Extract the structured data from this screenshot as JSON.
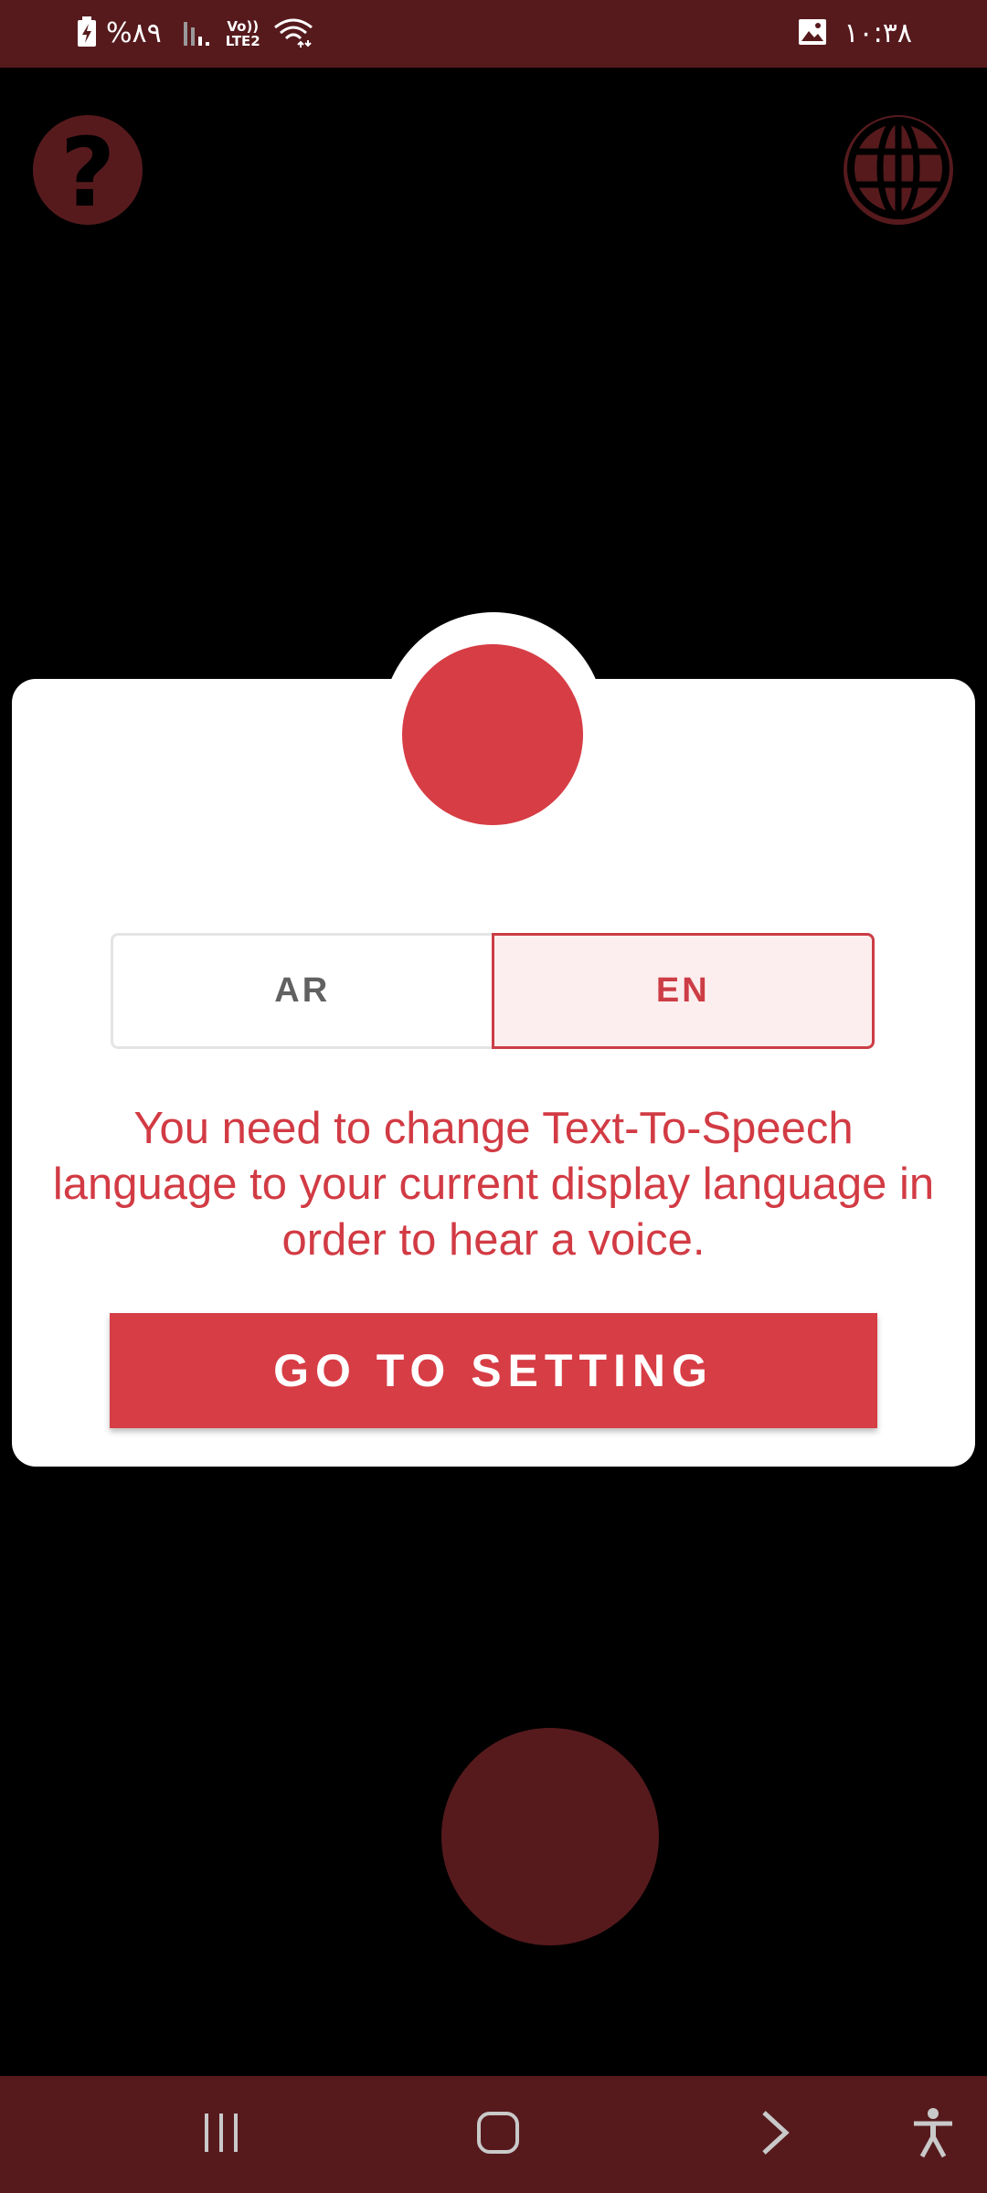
{
  "status_bar": {
    "battery": "%٨٩",
    "network_label": "Vo)) LTE2",
    "time": "١٠:٣٨",
    "icons": [
      "battery-charging-icon",
      "signal-icon",
      "wifi-icon",
      "gallery-icon"
    ]
  },
  "top_actions": {
    "help_icon": "question-mark-icon",
    "language_icon": "globe-icon"
  },
  "dialog": {
    "languages": [
      "AR",
      "EN"
    ],
    "selected_language": "EN",
    "message": "You need to change Text-To-Speech language to your current display language in order to hear a voice.",
    "button_label": "GO TO SETTING"
  },
  "nav_bar": {
    "icons": [
      "recent-apps-icon",
      "home-icon",
      "back-icon",
      "accessibility-icon"
    ]
  },
  "colors": {
    "accent": "#d73d45",
    "dark_red": "#561a1d",
    "background": "#000000"
  }
}
